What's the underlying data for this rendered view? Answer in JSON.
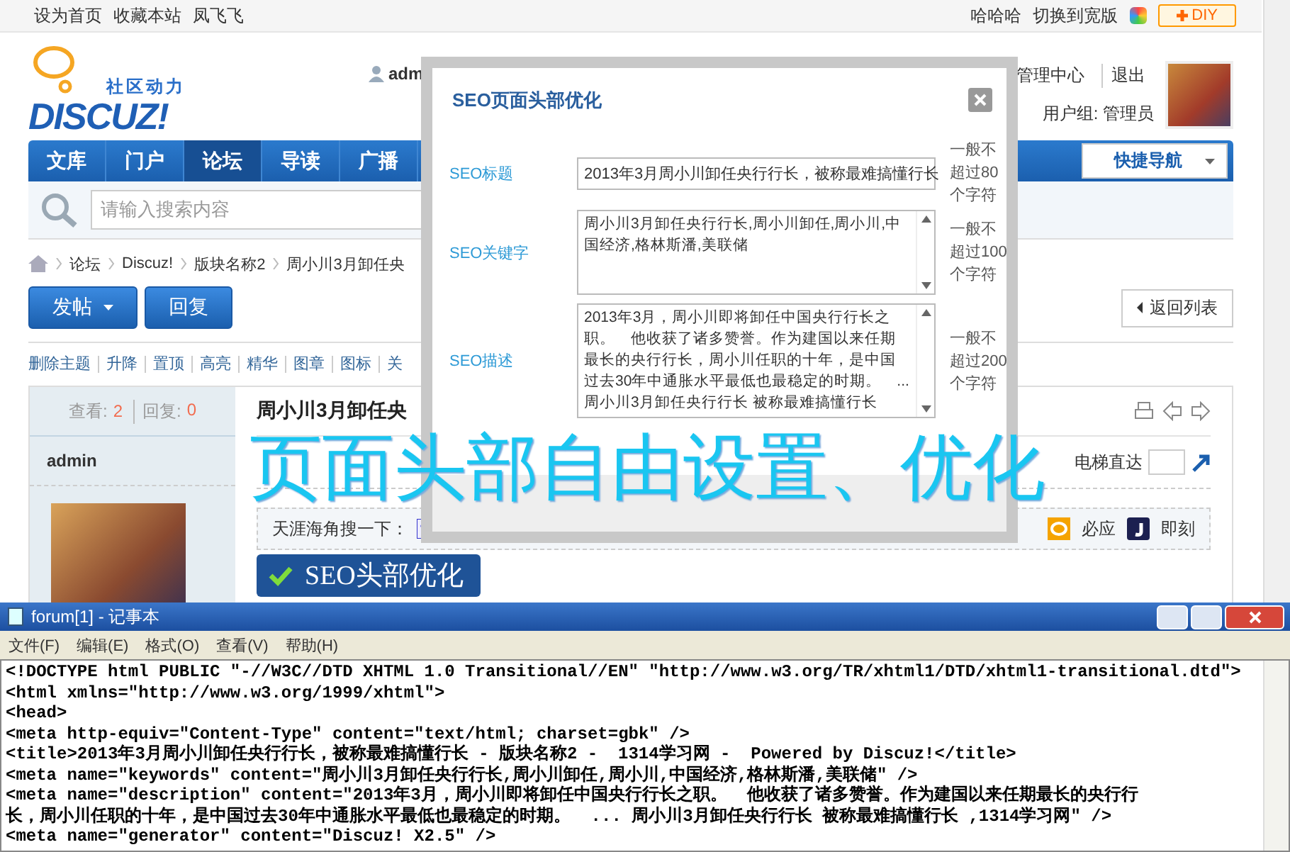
{
  "top_bar": {
    "links": [
      "设为首页",
      "收藏本站",
      "凤飞飞"
    ],
    "right_links": [
      "哈哈哈",
      "切换到宽版"
    ],
    "diy_button": "DIY"
  },
  "logo": {
    "slogan": "社区动力",
    "wordmark": "DISCUZ!"
  },
  "user_panel": {
    "username": "adm",
    "links": [
      "管理中心",
      "退出"
    ],
    "group": "用户组: 管理员"
  },
  "nav": {
    "items": [
      {
        "label": "文库",
        "selected": false
      },
      {
        "label": "门户",
        "selected": false
      },
      {
        "label": "论坛",
        "selected": true
      },
      {
        "label": "导读",
        "selected": false
      },
      {
        "label": "广播",
        "selected": false
      }
    ],
    "quick_nav": "快捷导航"
  },
  "search": {
    "placeholder": "请输入搜索内容"
  },
  "breadcrumb": [
    "论坛",
    "Discuz!",
    "版块名称2",
    "周小川3月卸任央"
  ],
  "actions": {
    "post": "发帖",
    "reply": "回复",
    "back": "返回列表"
  },
  "moderation": [
    "删除主题",
    "升降",
    "置顶",
    "高亮",
    "精华",
    "图章",
    "图标",
    "关"
  ],
  "thread": {
    "views_label": "查看:",
    "views": "2",
    "replies_label": "回复:",
    "replies": "0",
    "author": "admin",
    "title": "周小川3月卸任央",
    "jump_label": "电梯直达",
    "share_label": "天涯海角搜一下：",
    "share_items": [
      {
        "label": "必应"
      },
      {
        "label": "即刻"
      }
    ],
    "badge": "SEO头部优化"
  },
  "dialog": {
    "title": "SEO页面头部优化",
    "fields": [
      {
        "kind": "input",
        "label": "SEO标题",
        "value": "2013年3月周小川卸任央行行长，被称最难搞懂行长",
        "hint": "一般不超过80个字符"
      },
      {
        "kind": "textarea",
        "label": "SEO关键字",
        "value": "周小川3月卸任央行行长,周小川卸任,周小川,中国经济,格林斯潘,美联储",
        "hint": "一般不超过100个字符"
      },
      {
        "kind": "textarea",
        "label": "SEO描述",
        "value": "2013年3月，周小川即将卸任中国央行行长之职。　他收获了诸多赞誉。作为建国以来任期最长的央行行长，周小川任职的十年，是中国过去30年中通胀水平最低也最稳定的时期。　... 周小川3月卸任央行行长 被称最难搞懂行长",
        "hint": "一般不超过200个字符"
      }
    ]
  },
  "caption": "页面头部自由设置、优化",
  "notepad": {
    "title": "forum[1] - 记事本",
    "menu": [
      "文件(F)",
      "编辑(E)",
      "格式(O)",
      "查看(V)",
      "帮助(H)"
    ],
    "lines": [
      "<!DOCTYPE html PUBLIC \"-//W3C//DTD XHTML 1.0 Transitional//EN\" \"http://www.w3.org/TR/xhtml1/DTD/xhtml1-transitional.dtd\">",
      "<html xmlns=\"http://www.w3.org/1999/xhtml\">",
      "<head>",
      "<meta http-equiv=\"Content-Type\" content=\"text/html; charset=gbk\" />",
      "<title>2013年3月周小川卸任央行行长，被称最难搞懂行长 - 版块名称2 -  1314学习网 -  Powered by Discuz!</title>",
      "<meta name=\"keywords\" content=\"周小川3月卸任央行行长,周小川卸任,周小川,中国经济,格林斯潘,美联储\" />",
      "<meta name=\"description\" content=\"2013年3月，周小川即将卸任中国央行行长之职。  他收获了诸多赞誉。作为建国以来任期最长的央行行",
      "长，周小川任职的十年，是中国过去30年中通胀水平最低也最稳定的时期。  ... 周小川3月卸任央行行长 被称最难搞懂行长 ,1314学习网\" />",
      "<meta name=\"generator\" content=\"Discuz! X2.5\" />"
    ]
  }
}
